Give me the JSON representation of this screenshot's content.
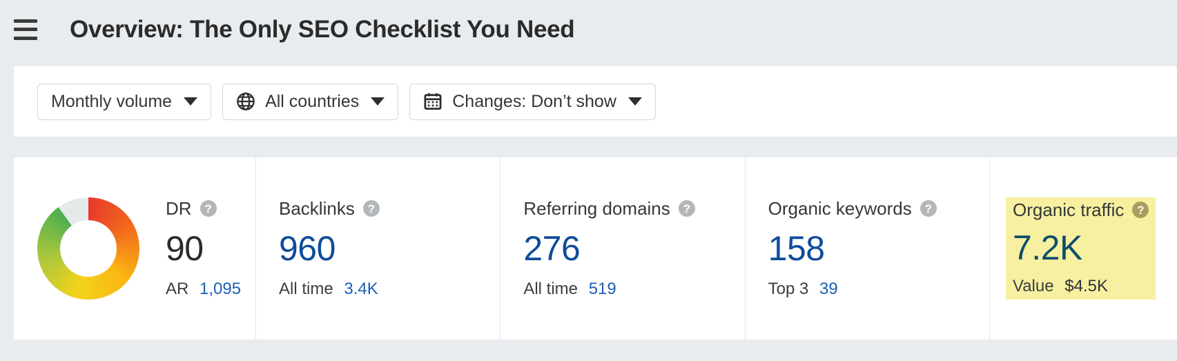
{
  "header": {
    "menu_icon": "hamburger-icon",
    "title": "Overview: The Only SEO Checklist You Need"
  },
  "filters": [
    {
      "id": "volume",
      "icon": "none",
      "label": "Monthly volume",
      "caret": "chevron-down-icon"
    },
    {
      "id": "countries",
      "icon": "globe-icon",
      "label": "All countries",
      "caret": "chevron-down-icon"
    },
    {
      "id": "changes",
      "icon": "calendar-icon",
      "label": "Changes: Don’t show",
      "caret": "chevron-down-icon"
    }
  ],
  "metrics": {
    "dr": {
      "label": "DR",
      "help_icon": "question-mark-icon",
      "value": "90",
      "sub_label": "AR",
      "sub_value": "1,095",
      "donut": {
        "percent": 90,
        "track_color": "#e6e9ea",
        "gradient": [
          "#e8392c",
          "#f26c1b",
          "#fbb712",
          "#f2d21b",
          "#a9c73c",
          "#4caf50"
        ]
      }
    },
    "cards": [
      {
        "id": "backlinks",
        "label": "Backlinks",
        "help_icon": "question-mark-icon",
        "value": "960",
        "value_color": "#0f4c9a",
        "sub_label": "All time",
        "sub_value": "3.4K",
        "highlighted": false
      },
      {
        "id": "referring-domains",
        "label": "Referring domains",
        "help_icon": "question-mark-icon",
        "value": "276",
        "value_color": "#0f4c9a",
        "sub_label": "All time",
        "sub_value": "519",
        "highlighted": false
      },
      {
        "id": "organic-keywords",
        "label": "Organic keywords",
        "help_icon": "question-mark-icon",
        "value": "158",
        "value_color": "#0f4c9a",
        "sub_label": "Top 3",
        "sub_value": "39",
        "highlighted": false
      },
      {
        "id": "organic-traffic",
        "label": "Organic traffic",
        "help_icon": "question-mark-icon",
        "value": "7.2K",
        "value_color": "#0d4f6c",
        "sub_label": "Value",
        "sub_value": "$4.5K",
        "highlighted": true,
        "highlight_color": "#f7f0a0"
      }
    ]
  },
  "colors": {
    "page_background": "#e8ecef",
    "card_background": "#ffffff",
    "link_blue": "#1a5fb4",
    "value_blue": "#0f4c9a",
    "highlight_yellow": "#f7f0a0",
    "text_dark": "#2b2b2b",
    "divider": "#e4e6e8"
  }
}
